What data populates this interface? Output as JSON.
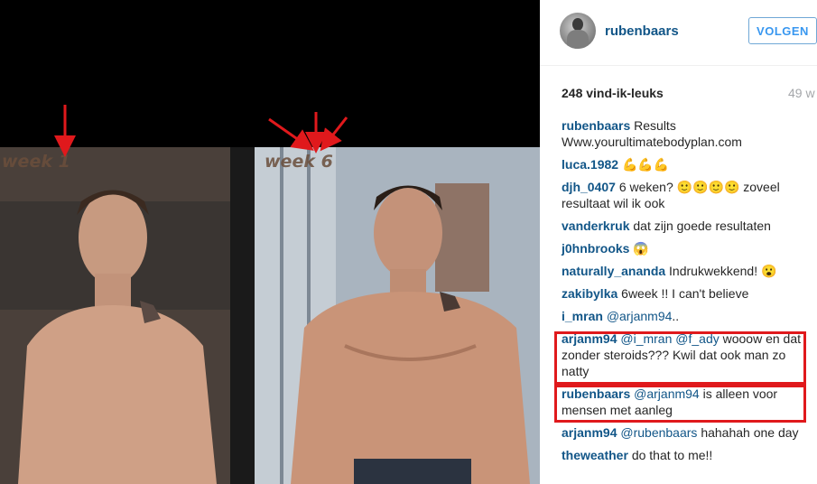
{
  "media": {
    "left_label": "week 1",
    "right_label": "week 6",
    "arrow_color": "#e0191c"
  },
  "post": {
    "username": "rubenbaars",
    "follow_label": "VOLGEN",
    "likes": "248 vind-ik-leuks",
    "time": "49 w"
  },
  "comments": [
    {
      "user": "rubenbaars",
      "text": "Results Www.yourultimatebodyplan.com"
    },
    {
      "user": "luca.1982",
      "text": "💪💪💪"
    },
    {
      "user": "djh_0407",
      "text": "6 weken? 🙂🙂🙂🙂 zoveel resultaat wil ik ook"
    },
    {
      "user": "vanderkruk",
      "text": "dat zijn goede resultaten"
    },
    {
      "user": "j0hnbrooks",
      "text": "😱"
    },
    {
      "user": "naturally_ananda",
      "text": "Indrukwekkend! 😮"
    },
    {
      "user": "zakibylka",
      "text": "6week !! I can't believe"
    },
    {
      "user": "i_mran",
      "mention": "@arjanm94",
      "text": ".."
    },
    {
      "user": "arjanm94",
      "mention": "@i_mran @f_ady",
      "text": "wooow en dat zonder steroids??? Kwil dat ook man zo natty"
    },
    {
      "user": "rubenbaars",
      "mention": "@arjanm94",
      "text": "is alleen voor mensen met aanleg"
    },
    {
      "user": "arjanm94",
      "mention": "@rubenbaars",
      "text": "hahahah one day"
    },
    {
      "user": "theweather",
      "text": "do that to me!!"
    }
  ],
  "highlight_color": "#e0191c"
}
